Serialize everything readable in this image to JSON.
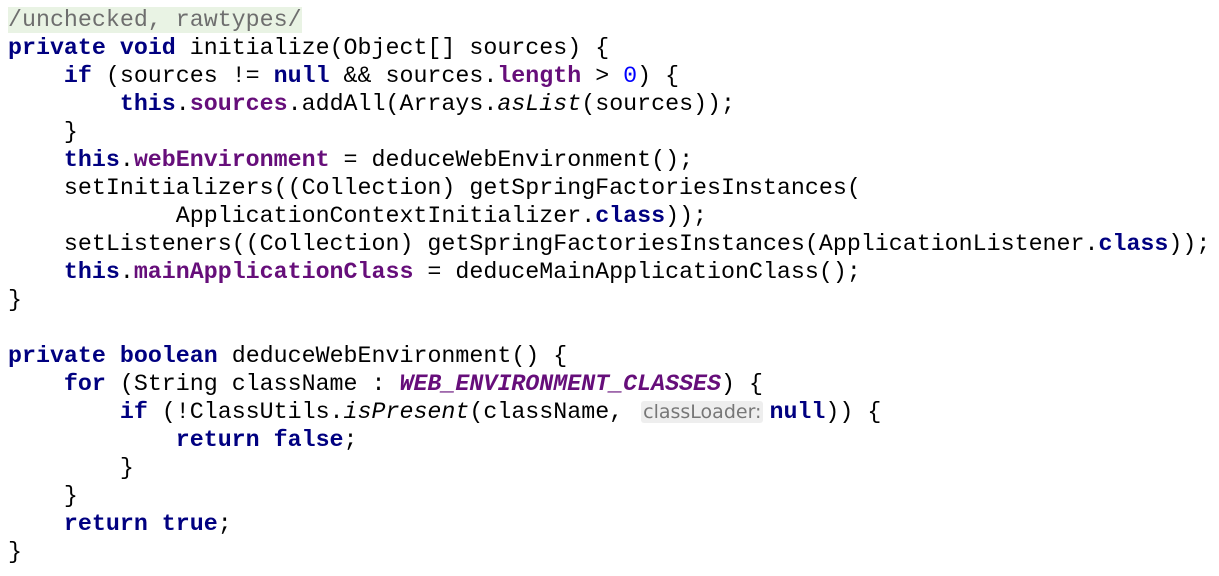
{
  "editor": {
    "lines": [
      [
        [
          "a",
          "/unchecked, rawtypes/"
        ]
      ],
      [
        [
          "k",
          "private"
        ],
        [
          "p",
          " "
        ],
        [
          "k",
          "void"
        ],
        [
          "p",
          " initialize(Object[] sources) {"
        ]
      ],
      [
        [
          "p",
          "    "
        ],
        [
          "k",
          "if"
        ],
        [
          "p",
          " (sources != "
        ],
        [
          "k",
          "null"
        ],
        [
          "p",
          " && sources."
        ],
        [
          "f",
          "length"
        ],
        [
          "p",
          " > "
        ],
        [
          "n",
          "0"
        ],
        [
          "p",
          ") {"
        ]
      ],
      [
        [
          "p",
          "        "
        ],
        [
          "k",
          "this"
        ],
        [
          "p",
          "."
        ],
        [
          "f",
          "sources"
        ],
        [
          "p",
          ".addAll(Arrays."
        ],
        [
          "s",
          "asList"
        ],
        [
          "p",
          "(sources));"
        ]
      ],
      [
        [
          "p",
          "    }"
        ]
      ],
      [
        [
          "p",
          "    "
        ],
        [
          "k",
          "this"
        ],
        [
          "p",
          "."
        ],
        [
          "f",
          "webEnvironment"
        ],
        [
          "p",
          " = deduceWebEnvironment();"
        ]
      ],
      [
        [
          "p",
          "    setInitializers((Collection) getSpringFactoriesInstances("
        ]
      ],
      [
        [
          "p",
          "            ApplicationContextInitializer."
        ],
        [
          "k",
          "class"
        ],
        [
          "p",
          "));"
        ]
      ],
      [
        [
          "p",
          "    setListeners((Collection) getSpringFactoriesInstances(ApplicationListener."
        ],
        [
          "k",
          "class"
        ],
        [
          "p",
          "));"
        ]
      ],
      [
        [
          "p",
          "    "
        ],
        [
          "k",
          "this"
        ],
        [
          "p",
          "."
        ],
        [
          "f",
          "mainApplicationClass"
        ],
        [
          "p",
          " = deduceMainApplicationClass();"
        ]
      ],
      [
        [
          "p",
          "}"
        ]
      ],
      [],
      [
        [
          "k",
          "private"
        ],
        [
          "p",
          " "
        ],
        [
          "k",
          "boolean"
        ],
        [
          "p",
          " deduceWebEnvironment() {"
        ]
      ],
      [
        [
          "p",
          "    "
        ],
        [
          "k",
          "for"
        ],
        [
          "p",
          " (String className : "
        ],
        [
          "sf",
          "WEB_ENVIRONMENT_CLASSES"
        ],
        [
          "p",
          ") {"
        ]
      ],
      [
        [
          "p",
          "        "
        ],
        [
          "k",
          "if"
        ],
        [
          "p",
          " (!ClassUtils."
        ],
        [
          "s",
          "isPresent"
        ],
        [
          "p",
          "(className, "
        ],
        [
          "h",
          "classLoader:"
        ],
        [
          "k",
          "null"
        ],
        [
          "p",
          ")) {"
        ]
      ],
      [
        [
          "p",
          "            "
        ],
        [
          "k",
          "return"
        ],
        [
          "p",
          " "
        ],
        [
          "k",
          "false"
        ],
        [
          "p",
          ";"
        ]
      ],
      [
        [
          "p",
          "        }"
        ]
      ],
      [
        [
          "p",
          "    }"
        ]
      ],
      [
        [
          "p",
          "    "
        ],
        [
          "k",
          "return"
        ],
        [
          "p",
          " "
        ],
        [
          "k",
          "true"
        ],
        [
          "p",
          ";"
        ]
      ],
      [
        [
          "p",
          "}"
        ]
      ]
    ]
  }
}
